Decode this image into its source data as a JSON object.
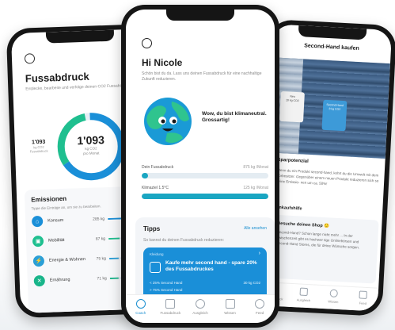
{
  "left_phone": {
    "title": "Fussabdruck",
    "description": "Entdecke, bearbeite und verfolge deinen CO2 Fussabdruck.",
    "ring": {
      "value": "1'093",
      "unit": "kg CO2",
      "per": "pro Monat"
    },
    "side": {
      "value": "1'093",
      "unit": "kg CO2",
      "label": "Fussabdruck"
    },
    "emissionen": {
      "title": "Emissionen",
      "hint": "Tippe die Einträge an, um sie zu bearbeiten.",
      "rows": [
        {
          "label": "Konsum",
          "value": "285 kg",
          "fraction": 0.55,
          "color": "#1a8fd8",
          "icon": "cart-icon",
          "glyph": "⌂"
        },
        {
          "label": "Mobilität",
          "value": "87 kg",
          "fraction": 0.3,
          "color": "#1fbf8f",
          "icon": "car-icon",
          "glyph": "▣"
        },
        {
          "label": "Energie & Wohnen",
          "value": "75 kg",
          "fraction": 0.25,
          "color": "#2a9fd6",
          "icon": "energy-icon",
          "glyph": "⚡"
        },
        {
          "label": "Ernährung",
          "value": "71 kg",
          "fraction": 0.22,
          "color": "#19b58a",
          "icon": "food-icon",
          "glyph": "✕"
        }
      ]
    }
  },
  "center_phone": {
    "greeting": "Hi Nicole",
    "subtitle": "Schön bist du da. Lass uns deinen Fussabdruck für eine nachhaltige Zukunft reduzieren.",
    "earth_message": "Wow, du bist klimaneutral. Grossartig!",
    "metrics": [
      {
        "label": "Dein Fussabdruck",
        "value": "875 kg /Monat",
        "fraction": 0.05
      },
      {
        "label": "Klimaziel 1.5°C",
        "value": "125 kg /Monat",
        "fraction": 1.0
      }
    ],
    "tipps": {
      "title": "Tipps",
      "all_label": "Alle ansehen",
      "subtitle": "So kannst du deinen Fussabdruck reduzieren:",
      "card": {
        "category": "Kleidung",
        "text": "Kaufe mehr second hand - spare 20% des Fussabdruckes",
        "rows": [
          {
            "left": "< 25% Second Hand",
            "right": "30 kg CO2"
          },
          {
            "left": "> 75% Second Hand",
            "right": ""
          }
        ]
      }
    },
    "tabs": [
      {
        "label": "Coach",
        "icon": "coach-icon",
        "active": true
      },
      {
        "label": "Fussabdruck",
        "icon": "footprint-icon",
        "active": false
      },
      {
        "label": "Ausgleich",
        "icon": "offset-icon",
        "active": false
      },
      {
        "label": "Wissen",
        "icon": "knowledge-icon",
        "active": false
      },
      {
        "label": "Feed",
        "icon": "feed-icon",
        "active": false
      }
    ]
  },
  "right_phone": {
    "title": "Second-Hand kaufen",
    "tags": [
      {
        "line1": "Neu",
        "line2": "10 kg CO2"
      },
      {
        "line1": "Second-Hand",
        "line2": "8 kg CO2"
      }
    ],
    "section1_title": "Sparpotenzial",
    "section1_text": "Wenn du ein Produkt second-hand, kehrt du die Umwelt mit dem Vorbesitzer. Gegenüber einem neuen Produkt reduzieren sich so deine Emissio- nen um ca. 50%!",
    "section2_title": "Einkaufshilfe",
    "card_title": "Besuche deinen Shop 🙂",
    "card_text": "Second-Hand? Schon lange nicht mehr ... In der Zwischenzeit gibt es hochwer tige Onlinebörsen und Second-Hand Stores, die für deine Wünsche sorgen.",
    "tabs": [
      {
        "label": "Fussabdruck",
        "icon": "footprint-icon"
      },
      {
        "label": "Ausgleich",
        "icon": "offset-icon"
      },
      {
        "label": "Wissen",
        "icon": "knowledge-icon"
      },
      {
        "label": "Feed",
        "icon": "feed-icon"
      }
    ]
  },
  "colors": {
    "accent": "#1a8fd0",
    "teal": "#1aa6c2",
    "ring_blue": "#1a8fd8",
    "ring_green": "#1fbf8f"
  }
}
